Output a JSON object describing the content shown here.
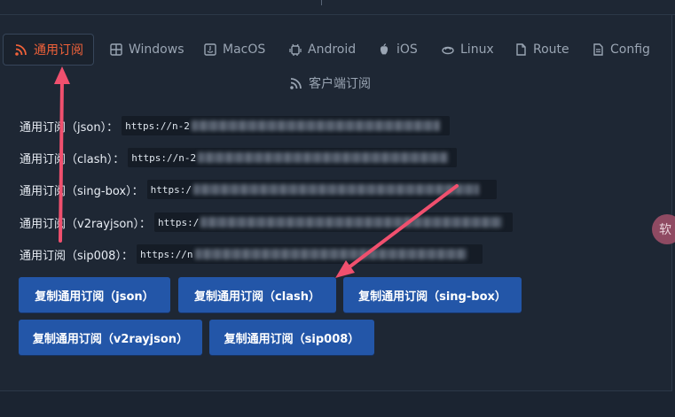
{
  "tabs": [
    {
      "label": "通用订阅",
      "icon": "rss-icon",
      "active": true
    },
    {
      "label": "Windows",
      "icon": "windows-icon",
      "active": false
    },
    {
      "label": "MacOS",
      "icon": "macos-icon",
      "active": false
    },
    {
      "label": "Android",
      "icon": "android-icon",
      "active": false
    },
    {
      "label": "iOS",
      "icon": "apple-icon",
      "active": false
    },
    {
      "label": "Linux",
      "icon": "linux-icon",
      "active": false
    },
    {
      "label": "Route",
      "icon": "route-icon",
      "active": false
    },
    {
      "label": "Config",
      "icon": "config-icon",
      "active": false
    },
    {
      "label": "客户端订阅",
      "icon": "rss-icon",
      "active": false
    }
  ],
  "subscriptions": [
    {
      "label": "通用订阅（json）：",
      "url_prefix": "https://n-2"
    },
    {
      "label": "通用订阅（clash）：",
      "url_prefix": "https://n-2"
    },
    {
      "label": "通用订阅（sing-box）：",
      "url_prefix": "https:/"
    },
    {
      "label": "通用订阅（v2rayjson）：",
      "url_prefix": "https:/"
    },
    {
      "label": "通用订阅（sip008）：",
      "url_prefix": "https://n"
    }
  ],
  "buttons": [
    {
      "label": "复制通用订阅（json）"
    },
    {
      "label": "复制通用订阅（clash）"
    },
    {
      "label": "复制通用订阅（sing-box）"
    },
    {
      "label": "复制通用订阅（v2rayjson）"
    },
    {
      "label": "复制通用订阅（sip008）"
    }
  ],
  "side_bubble": {
    "text": "软"
  },
  "colors": {
    "accent": "#f0623a",
    "button": "#2356a8",
    "background": "#1e2734",
    "annotation_arrow": "#f0506e"
  }
}
